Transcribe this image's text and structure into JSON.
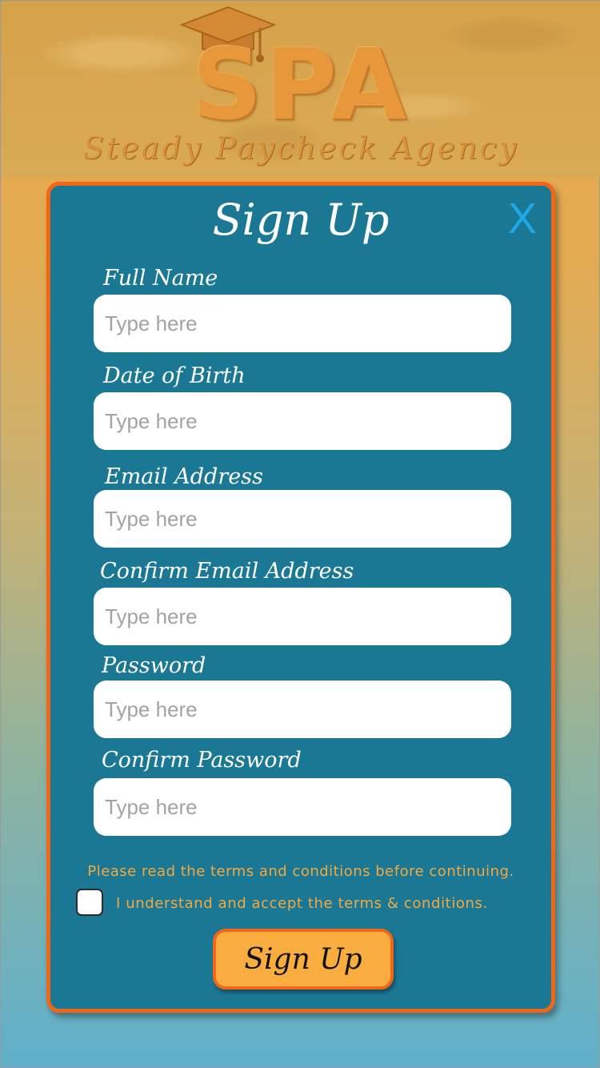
{
  "app": {
    "logo_text": "SPA",
    "logo_subtitle": "Steady Paycheck Agency"
  },
  "modal": {
    "title": "Sign Up",
    "close_label": "X"
  },
  "form": {
    "fields": [
      {
        "label": "Full Name",
        "placeholder": "Type here",
        "value": ""
      },
      {
        "label": "Date of Birth",
        "placeholder": "Type here",
        "value": ""
      },
      {
        "label": "Email Address",
        "placeholder": "Type here",
        "value": ""
      },
      {
        "label": "Confirm Email Address",
        "placeholder": "Type here",
        "value": ""
      },
      {
        "label": "Password",
        "placeholder": "Type here",
        "value": ""
      },
      {
        "label": "Confirm Password",
        "placeholder": "Type here",
        "value": ""
      }
    ],
    "terms_note": "Please read the terms and conditions before continuing.",
    "terms_accept": "I understand and accept the terms & conditions.",
    "terms_checked": false,
    "submit_label": "Sign Up"
  },
  "colors": {
    "modal_bg": "#1b7895",
    "modal_border": "#f2661a",
    "close_icon": "#1fa8e6",
    "terms_text": "#f3a940",
    "button_bg": "#f9ad3e"
  },
  "icons": {
    "logo": "graduation-cap-icon",
    "close": "close-icon",
    "checkbox": "checkbox-icon"
  }
}
